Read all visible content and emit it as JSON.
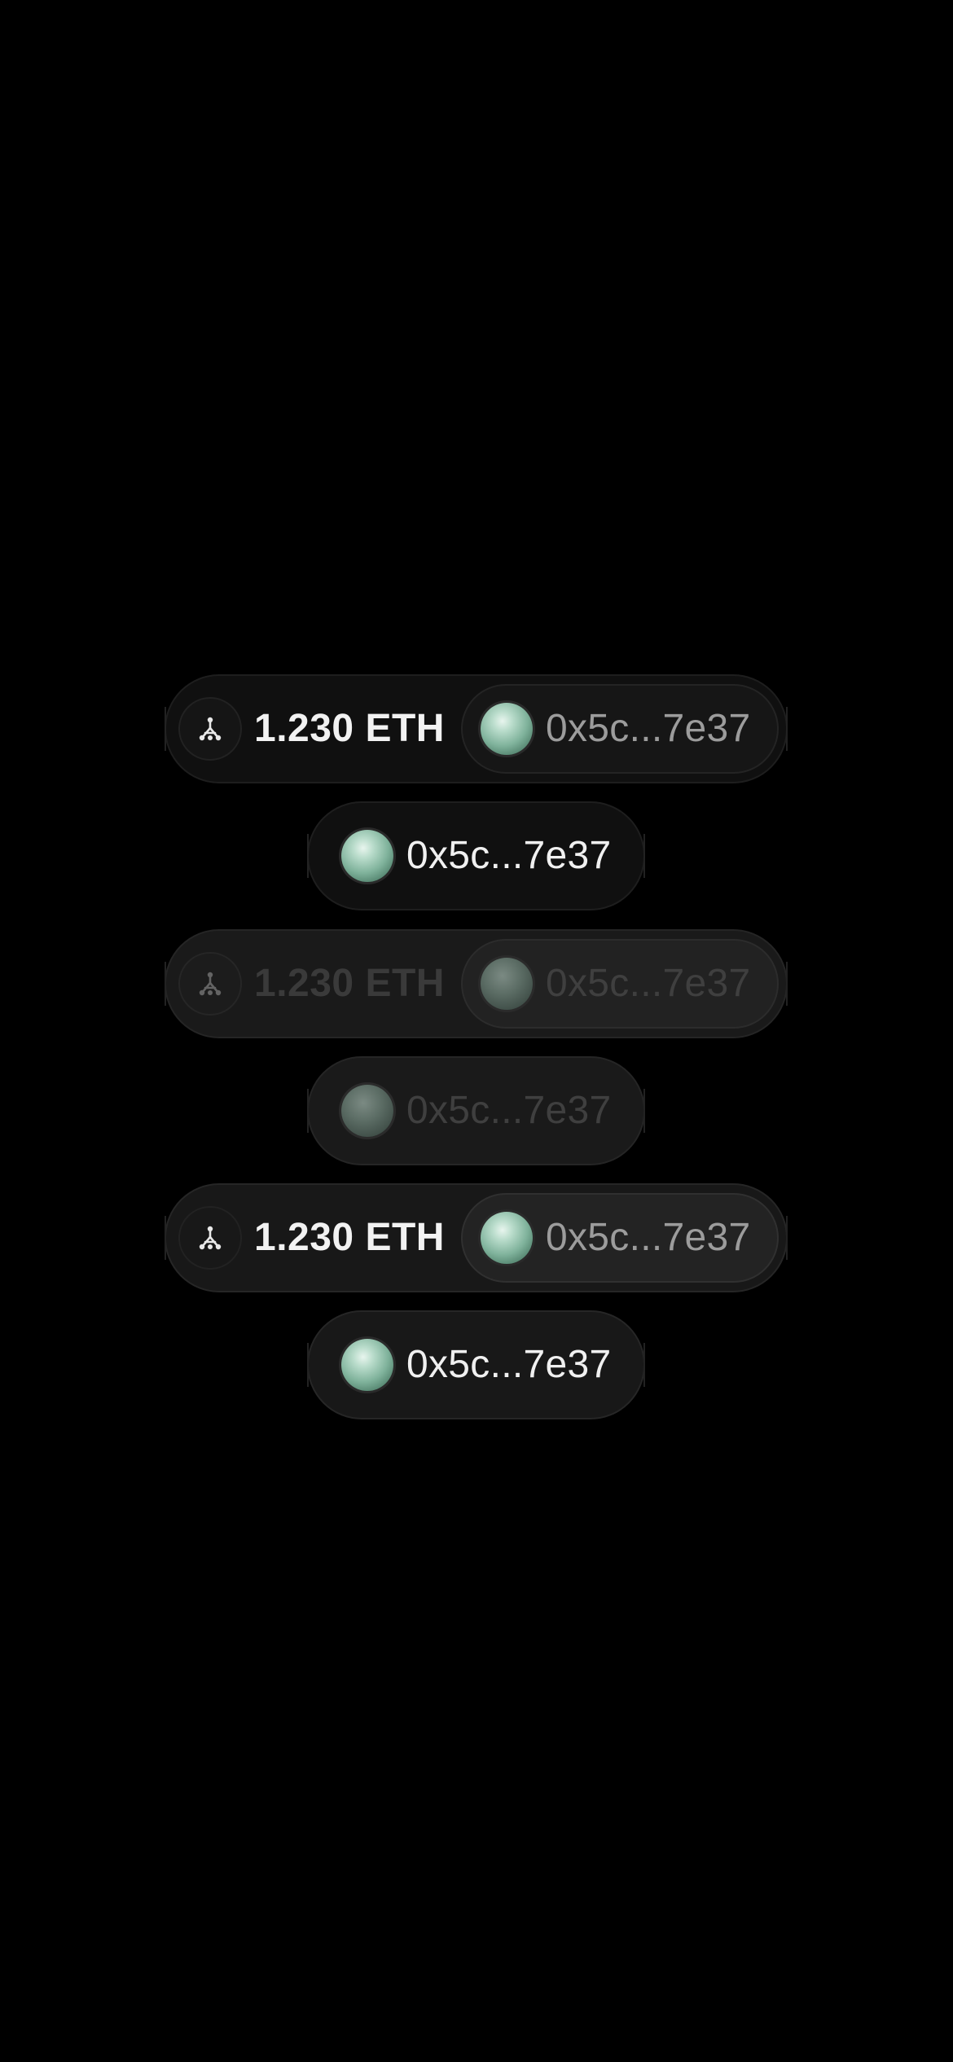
{
  "widgets": [
    {
      "variant": "full",
      "state": "default",
      "balance": "1.230 ETH",
      "address": "0x5c...7e37",
      "icon": "eth-network-icon"
    },
    {
      "variant": "address-only",
      "state": "default",
      "address": "0x5c...7e37"
    },
    {
      "variant": "full",
      "state": "disabled",
      "balance": "1.230 ETH",
      "address": "0x5c...7e37",
      "icon": "eth-network-icon"
    },
    {
      "variant": "address-only",
      "state": "disabled",
      "address": "0x5c...7e37"
    },
    {
      "variant": "full",
      "state": "hover",
      "balance": "1.230 ETH",
      "address": "0x5c...7e37",
      "icon": "eth-network-icon"
    },
    {
      "variant": "address-only",
      "state": "hover",
      "address": "0x5c...7e37"
    }
  ],
  "colors": {
    "background": "#000000",
    "pill": "#101010",
    "avatar_accent": "#7fb29b",
    "text_primary": "#f2f2f2",
    "text_secondary": "#9c9c9c"
  }
}
